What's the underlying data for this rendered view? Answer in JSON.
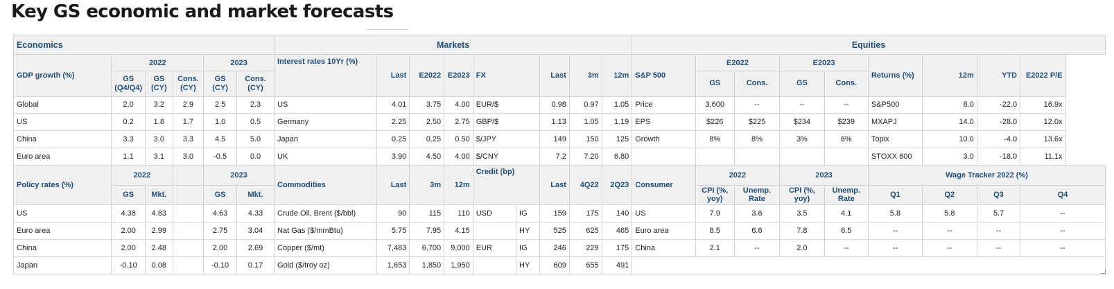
{
  "title": "Key GS economic and market forecasts",
  "sections": {
    "economics": "Economics",
    "markets": "Markets",
    "equities": "Equities"
  },
  "gdp": {
    "label": "GDP growth (%)",
    "year1": "2022",
    "year2": "2023",
    "cols": [
      "GS (Q4/Q4)",
      "GS (CY)",
      "Cons. (CY)",
      "GS (CY)",
      "Cons. (CY)"
    ],
    "rows": [
      {
        "name": "Global",
        "v": [
          "2.0",
          "3.2",
          "2.9",
          "2.5",
          "2.3"
        ]
      },
      {
        "name": "US",
        "v": [
          "0.2",
          "1.8",
          "1.7",
          "1.0",
          "0.5"
        ]
      },
      {
        "name": "China",
        "v": [
          "3.3",
          "3.0",
          "3.3",
          "4.5",
          "5.0"
        ]
      },
      {
        "name": "Euro area",
        "v": [
          "1.1",
          "3.1",
          "3.0",
          "-0.5",
          "0.0"
        ]
      }
    ]
  },
  "rates": {
    "label": "Interest rates 10Yr (%)",
    "cols": [
      "Last",
      "E2022",
      "E2023"
    ],
    "rows": [
      {
        "name": "US",
        "v": [
          "4.01",
          "3.75",
          "4.00"
        ]
      },
      {
        "name": "Germany",
        "v": [
          "2.25",
          "2.50",
          "2.75"
        ]
      },
      {
        "name": "Japan",
        "v": [
          "0.25",
          "0.25",
          "0.50"
        ]
      },
      {
        "name": "UK",
        "v": [
          "3.90",
          "4.50",
          "4.00"
        ]
      }
    ]
  },
  "fx": {
    "label": "FX",
    "cols": [
      "Last",
      "3m",
      "12m"
    ],
    "rows": [
      {
        "name": "EUR/$",
        "v": [
          "0.98",
          "0.97",
          "1.05"
        ]
      },
      {
        "name": "GBP/$",
        "v": [
          "1.13",
          "1.05",
          "1.19"
        ]
      },
      {
        "name": "$/JPY",
        "v": [
          "149",
          "150",
          "125"
        ]
      },
      {
        "name": "$/CNY",
        "v": [
          "7.2",
          "7.20",
          "6.80"
        ]
      }
    ]
  },
  "sp500": {
    "label": "S&P 500",
    "year1": "E2022",
    "year2": "E2023",
    "cols": [
      "GS",
      "Cons.",
      "GS",
      "Cons."
    ],
    "rows": [
      {
        "name": "Price",
        "v": [
          "3,600",
          "--",
          "--",
          "--"
        ]
      },
      {
        "name": "EPS",
        "v": [
          "$226",
          "$225",
          "$234",
          "$239"
        ]
      },
      {
        "name": "Growth",
        "v": [
          "8%",
          "8%",
          "3%",
          "6%"
        ]
      }
    ]
  },
  "returns": {
    "label": "Returns (%)",
    "cols": [
      "12m",
      "YTD",
      "E2022 P/E"
    ],
    "rows": [
      {
        "name": "S&P500",
        "v": [
          "8.0",
          "-22.0",
          "16.9x"
        ]
      },
      {
        "name": "MXAPJ",
        "v": [
          "14.0",
          "-28.0",
          "12.0x"
        ]
      },
      {
        "name": "Topix",
        "v": [
          "10.0",
          "-4.0",
          "13.6x"
        ]
      },
      {
        "name": "STOXX 600",
        "v": [
          "3.0",
          "-18.0",
          "11.1x"
        ]
      }
    ]
  },
  "policy": {
    "label": "Policy rates (%)",
    "year1": "2022",
    "year2": "2023",
    "cols": [
      "GS",
      "Mkt.",
      "GS",
      "Mkt."
    ],
    "rows": [
      {
        "name": "US",
        "v": [
          "4.38",
          "4.83",
          "4.63",
          "4.33"
        ]
      },
      {
        "name": "Euro area",
        "v": [
          "2.00",
          "2.99",
          "2.75",
          "3.04"
        ]
      },
      {
        "name": "China",
        "v": [
          "2.00",
          "2.48",
          "2.00",
          "2.69"
        ]
      },
      {
        "name": "Japan",
        "v": [
          "-0.10",
          "0.08",
          "-0.10",
          "0.17"
        ]
      }
    ]
  },
  "commodities": {
    "label": "Commodities",
    "cols": [
      "Last",
      "3m",
      "12m"
    ],
    "rows": [
      {
        "name": "Crude Oil, Brent ($/bbl)",
        "v": [
          "90",
          "115",
          "110"
        ]
      },
      {
        "name": "Nat Gas ($/mmBtu)",
        "v": [
          "5.75",
          "7.95",
          "4.15"
        ]
      },
      {
        "name": "Copper ($/mt)",
        "v": [
          "7,483",
          "6,700",
          "9,000"
        ]
      },
      {
        "name": "Gold ($/troy oz)",
        "v": [
          "1,653",
          "1,850",
          "1,950"
        ]
      }
    ]
  },
  "credit": {
    "label": "Credit (bp)",
    "cols": [
      "Last",
      "4Q22",
      "2Q23"
    ],
    "rows": [
      {
        "region": "USD",
        "grade": "IG",
        "v": [
          "159",
          "175",
          "140"
        ]
      },
      {
        "region": "",
        "grade": "HY",
        "v": [
          "525",
          "625",
          "465"
        ]
      },
      {
        "region": "EUR",
        "grade": "IG",
        "v": [
          "246",
          "229",
          "175"
        ]
      },
      {
        "region": "",
        "grade": "HY",
        "v": [
          "609",
          "655",
          "491"
        ]
      }
    ]
  },
  "consumer": {
    "label": "Consumer",
    "year1": "2022",
    "year2": "2023",
    "cols": [
      "CPI (%, yoy)",
      "Unemp. Rate",
      "CPI (%, yoy)",
      "Unemp. Rate"
    ],
    "rows": [
      {
        "name": "US",
        "v": [
          "7.9",
          "3.6",
          "3.5",
          "4.1"
        ]
      },
      {
        "name": "Euro area",
        "v": [
          "8.5",
          "6.6",
          "7.8",
          "6.5"
        ]
      },
      {
        "name": "China",
        "v": [
          "2.1",
          "--",
          "2.0",
          "--"
        ]
      }
    ]
  },
  "wage": {
    "label": "Wage Tracker 2022 (%)",
    "cols": [
      "Q1",
      "Q2",
      "Q3",
      "Q4"
    ],
    "rows": [
      {
        "v": [
          "5.8",
          "5.8",
          "5.7",
          "--"
        ]
      },
      {
        "v": [
          "--",
          "--",
          "--",
          "--"
        ]
      },
      {
        "v": [
          "--",
          "--",
          "--",
          "--"
        ]
      }
    ]
  }
}
